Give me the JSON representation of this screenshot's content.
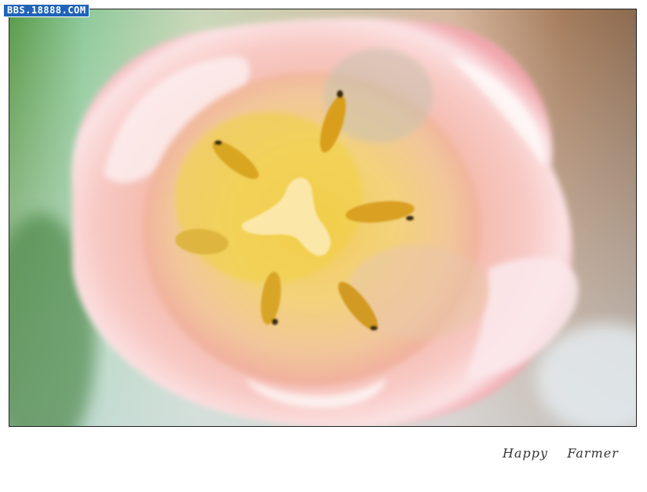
{
  "watermark": {
    "text": "BBS.18888.COM"
  },
  "signature": {
    "text": "Happy    Farmer"
  }
}
